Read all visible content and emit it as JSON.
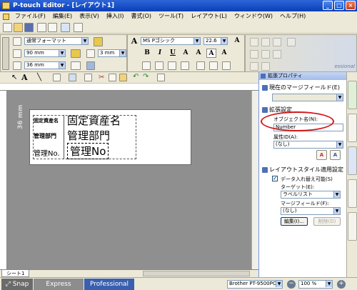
{
  "window": {
    "title": "P-touch Editor - [レイアウト1]"
  },
  "menu": [
    "ファイル(F)",
    "編集(E)",
    "表示(V)",
    "挿入(I)",
    "書式(O)",
    "ツール(T)",
    "レイアウト(L)",
    "ウィンドウ(W)",
    "ヘルプ(H)"
  ],
  "paper": {
    "format": "通常フォーマット",
    "length": "90 mm",
    "width": "36 mm",
    "margin": "3 mm",
    "ruler_label": "36 mm"
  },
  "font": {
    "name": "MS Pゴシック",
    "size": "22.6",
    "brand_watermark": "essional"
  },
  "label": {
    "rows": [
      {
        "caption": "固定資産名",
        "value": "固定資産名"
      },
      {
        "caption": "管理部門",
        "value": "管理部門"
      },
      {
        "caption": "管理No.",
        "value": "管理No"
      }
    ]
  },
  "sheet_tab": "シート1",
  "modes": {
    "snap": "Snap",
    "express": "Express",
    "professional": "Professional"
  },
  "status": {
    "printer": "Brother PT-9500PC",
    "zoom": "100 %"
  },
  "properties": {
    "title": "拡張プロパティ",
    "current_merge_section": "現在のマージフィールド(E)",
    "current_merge_value": "",
    "ext_section": "拡張設定",
    "object_name_label": "オブジェクト名(N):",
    "object_name_value": "Number",
    "attribute_label": "属性ID(A):",
    "attribute_value": "(なし)",
    "layout_section": "レイアウトスタイル適用設定",
    "swap_checkbox": "データ入れ替え可能(S)",
    "swap_checked": true,
    "target_label": "ターゲット(E):",
    "target_value": "ラベルリスト",
    "mergefield_label": "マージフィールド(F):",
    "mergefield_value": "(なし)",
    "edit_button": "編集(I)...",
    "delete_button": "削除(D)"
  },
  "colors": {
    "title_blue": "#0a3fb8",
    "professional_tab": "#3a5fae",
    "highlight_ellipse": "#d21a1a"
  }
}
